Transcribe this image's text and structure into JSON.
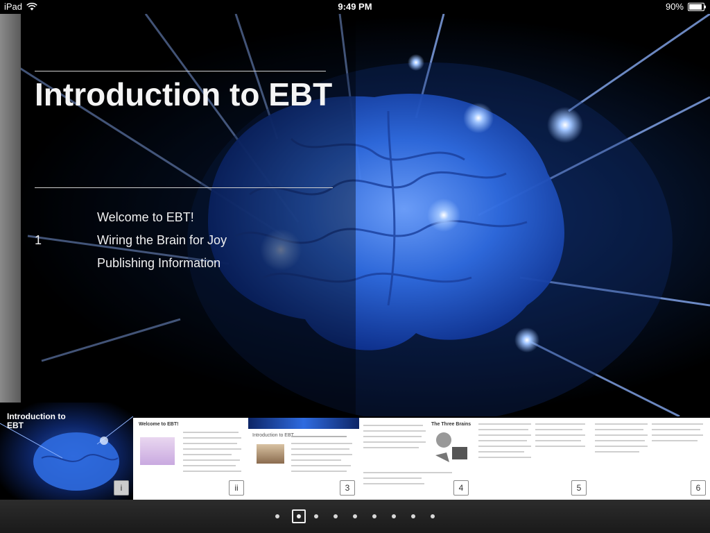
{
  "status_bar": {
    "device": "iPad",
    "time": "9:49 PM",
    "battery": "90%",
    "battery_level": 0.9
  },
  "book": {
    "title": "Introduction to EBT",
    "toc": [
      {
        "number": "",
        "label": "Welcome to EBT!"
      },
      {
        "number": "1",
        "label": "Wiring the Brain for Joy"
      },
      {
        "number": "",
        "label": "Publishing Information"
      }
    ]
  },
  "thumbnails": [
    {
      "page_number": "i",
      "title": "Introduction to EBT"
    },
    {
      "page_number": "ii",
      "title": "Welcome to EBT!"
    },
    {
      "page_number": "3",
      "title": "Introduction to EBT"
    },
    {
      "page_number": "4",
      "title": "The Three Brains"
    },
    {
      "page_number": "5",
      "title": ""
    },
    {
      "page_number": "6",
      "title": ""
    }
  ],
  "page_dots": {
    "count": 9,
    "active_index": 1
  },
  "colors": {
    "brain_blue": "#2f6be0",
    "background": "#000000",
    "dock": "#1f1f1f"
  }
}
